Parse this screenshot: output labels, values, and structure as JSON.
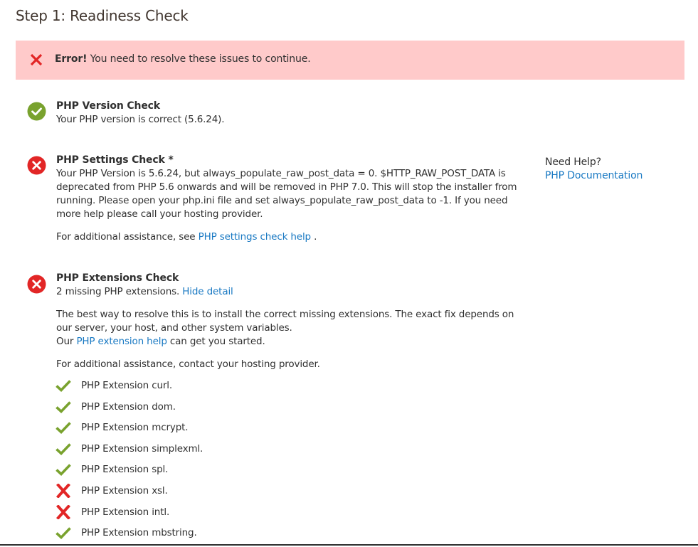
{
  "page": {
    "title": "Step 1: Readiness Check"
  },
  "error": {
    "strong": "Error!",
    "message": " You need to resolve these issues to continue.",
    "icon": "close-icon",
    "color": "#e22626"
  },
  "checks": {
    "php_version": {
      "status": "success",
      "icon": "checkmark-circle-icon",
      "title": "PHP Version Check",
      "text": "Your PHP version is correct (5.6.24)."
    },
    "php_settings": {
      "status": "error",
      "icon": "close-circle-icon",
      "title": "PHP Settings Check *",
      "text": "Your PHP Version is 5.6.24, but always_populate_raw_post_data = 0. $HTTP_RAW_POST_DATA is deprecated from PHP 5.6 onwards and will be removed in PHP 7.0. This will stop the installer from running. Please open your php.ini file and set always_populate_raw_post_data to -1. If you need more help please call your hosting provider.",
      "assist_prefix": "For additional assistance, see ",
      "assist_link": "PHP settings check help",
      "assist_suffix": " ."
    },
    "php_extensions": {
      "status": "error",
      "icon": "close-circle-icon",
      "title": "PHP Extensions Check",
      "summary": "2 missing PHP extensions. ",
      "toggle_link": "Hide detail",
      "resolve_text": "The best way to resolve this is to install the correct missing extensions. The exact fix depends on our server, your host, and other system variables.",
      "our_prefix": "Our ",
      "help_link": "PHP extension help",
      "our_suffix": " can get you started.",
      "assist_text": "For additional assistance, contact your hosting provider.",
      "extensions": [
        {
          "label": "PHP Extension curl.",
          "ok": true
        },
        {
          "label": "PHP Extension dom.",
          "ok": true
        },
        {
          "label": "PHP Extension mcrypt.",
          "ok": true
        },
        {
          "label": "PHP Extension simplexml.",
          "ok": true
        },
        {
          "label": "PHP Extension spl.",
          "ok": true
        },
        {
          "label": "PHP Extension xsl.",
          "ok": false
        },
        {
          "label": "PHP Extension intl.",
          "ok": false
        },
        {
          "label": "PHP Extension mbstring.",
          "ok": true
        }
      ]
    }
  },
  "help": {
    "heading": "Need Help?",
    "link": "PHP Documentation"
  },
  "colors": {
    "success": "#79a22e",
    "error": "#e22626",
    "link": "#1979c3",
    "banner": "#ffcaca"
  }
}
